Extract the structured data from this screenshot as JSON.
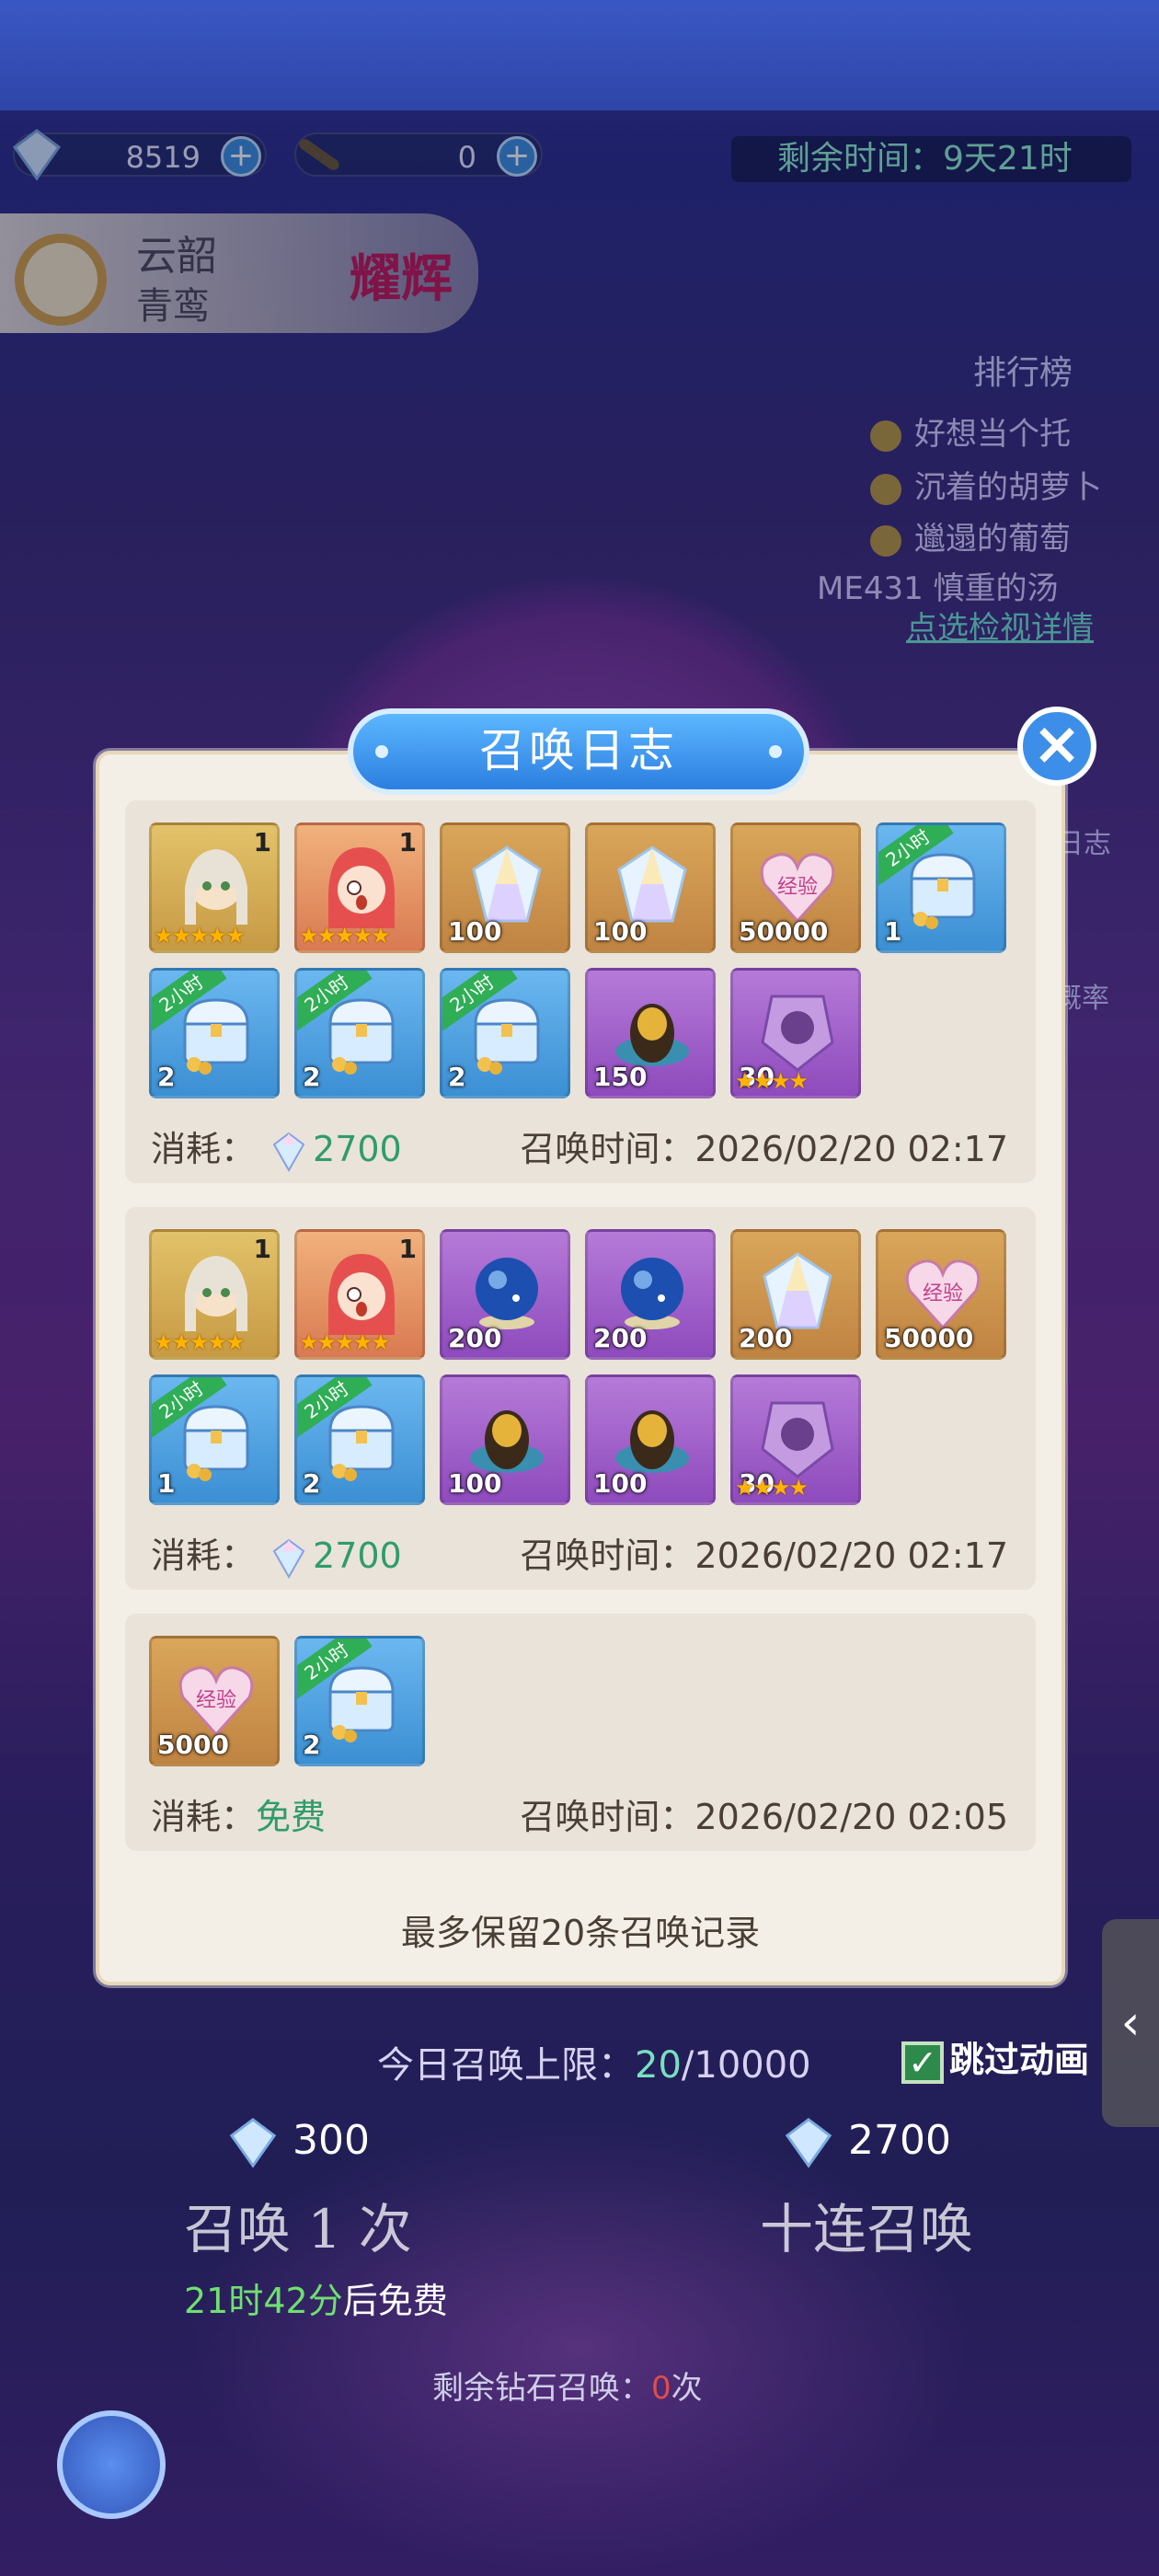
{
  "resources": {
    "diamonds": "8519",
    "scrolls": "0"
  },
  "timer": {
    "label": "剩余时间：",
    "value": "9天21时"
  },
  "banner": {
    "line1": "云韶",
    "line2": "青鸾",
    "badge": "耀辉"
  },
  "ranking": {
    "title": "排行榜",
    "entries": [
      "好想当个托",
      "沉着的胡萝卜",
      "邋遢的葡萄",
      "ME431 慎重的汤"
    ],
    "link": "点选检视详情"
  },
  "side_labels": {
    "log": "日志",
    "rate": "概率"
  },
  "modal": {
    "title": "召唤日志",
    "close": "×",
    "cost_label": "消耗：",
    "time_label": "召唤时间：",
    "footnote": "最多保留20条召唤记录",
    "ribbon_text": "2小时",
    "records": [
      {
        "cost": "2700",
        "time": "2026/02/20 02:17",
        "items": [
          {
            "type": "hero-fairy",
            "qty": "",
            "rank": "1",
            "stars": "★★★★★"
          },
          {
            "type": "hero-girl",
            "qty": "",
            "rank": "1",
            "stars": "★★★★★"
          },
          {
            "type": "crystal",
            "qty": "100"
          },
          {
            "type": "crystal",
            "qty": "100"
          },
          {
            "type": "exp-heart",
            "qty": "50000"
          },
          {
            "type": "chest",
            "qty": "1",
            "ribbon": true
          },
          {
            "type": "chest",
            "qty": "2",
            "ribbon": true
          },
          {
            "type": "chest",
            "qty": "2",
            "ribbon": true
          },
          {
            "type": "chest",
            "qty": "2",
            "ribbon": true
          },
          {
            "type": "egg",
            "qty": "150"
          },
          {
            "type": "shard",
            "qty": "30",
            "stars": "★★★★"
          }
        ]
      },
      {
        "cost": "2700",
        "time": "2026/02/20 02:17",
        "items": [
          {
            "type": "hero-fairy",
            "qty": "",
            "rank": "1",
            "stars": "★★★★★"
          },
          {
            "type": "hero-girl",
            "qty": "",
            "rank": "1",
            "stars": "★★★★★"
          },
          {
            "type": "orb",
            "qty": "200"
          },
          {
            "type": "orb",
            "qty": "200"
          },
          {
            "type": "crystal",
            "qty": "200"
          },
          {
            "type": "exp-heart",
            "qty": "50000"
          },
          {
            "type": "chest",
            "qty": "1",
            "ribbon": true
          },
          {
            "type": "chest",
            "qty": "2",
            "ribbon": true
          },
          {
            "type": "egg",
            "qty": "100"
          },
          {
            "type": "egg",
            "qty": "100"
          },
          {
            "type": "shard",
            "qty": "30",
            "stars": "★★★★"
          }
        ]
      },
      {
        "cost": "免费",
        "free": true,
        "time": "2026/02/20 02:05",
        "items": [
          {
            "type": "exp-heart",
            "qty": "5000"
          },
          {
            "type": "chest",
            "qty": "2",
            "ribbon": true
          }
        ]
      }
    ]
  },
  "daily_limit": {
    "label": "今日召唤上限：",
    "current": "20",
    "max": "/10000"
  },
  "skip": {
    "label": "跳过动画",
    "check": "✓"
  },
  "prices": {
    "single": "300",
    "ten": "2700"
  },
  "buttons": {
    "single": "召唤 1 次",
    "ten": "十连召唤"
  },
  "free_timer": {
    "time": "21时42分",
    "suffix": "后免费"
  },
  "remaining": {
    "prefix": "剩余钻石召唤：",
    "count": "0",
    "suffix": "次"
  },
  "side_tab_icon": "‹"
}
